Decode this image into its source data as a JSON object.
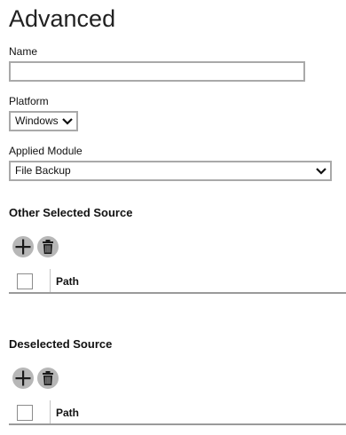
{
  "page": {
    "title": "Advanced"
  },
  "form": {
    "name_label": "Name",
    "name_value": "",
    "platform_label": "Platform",
    "platform_selected": "Windows",
    "module_label": "Applied Module",
    "module_selected": "File Backup"
  },
  "other_selected_source": {
    "heading": "Other Selected Source",
    "add_icon": "plus-icon",
    "delete_icon": "trash-icon",
    "columns": [
      "Path"
    ]
  },
  "deselected_source": {
    "heading": "Deselected Source",
    "add_icon": "plus-icon",
    "delete_icon": "trash-icon",
    "columns": [
      "Path"
    ]
  },
  "colors": {
    "icon_button_bg": "#b7b7b7",
    "icon_glyph": "#1a1a1a",
    "input_border": "#a9a9a9"
  }
}
